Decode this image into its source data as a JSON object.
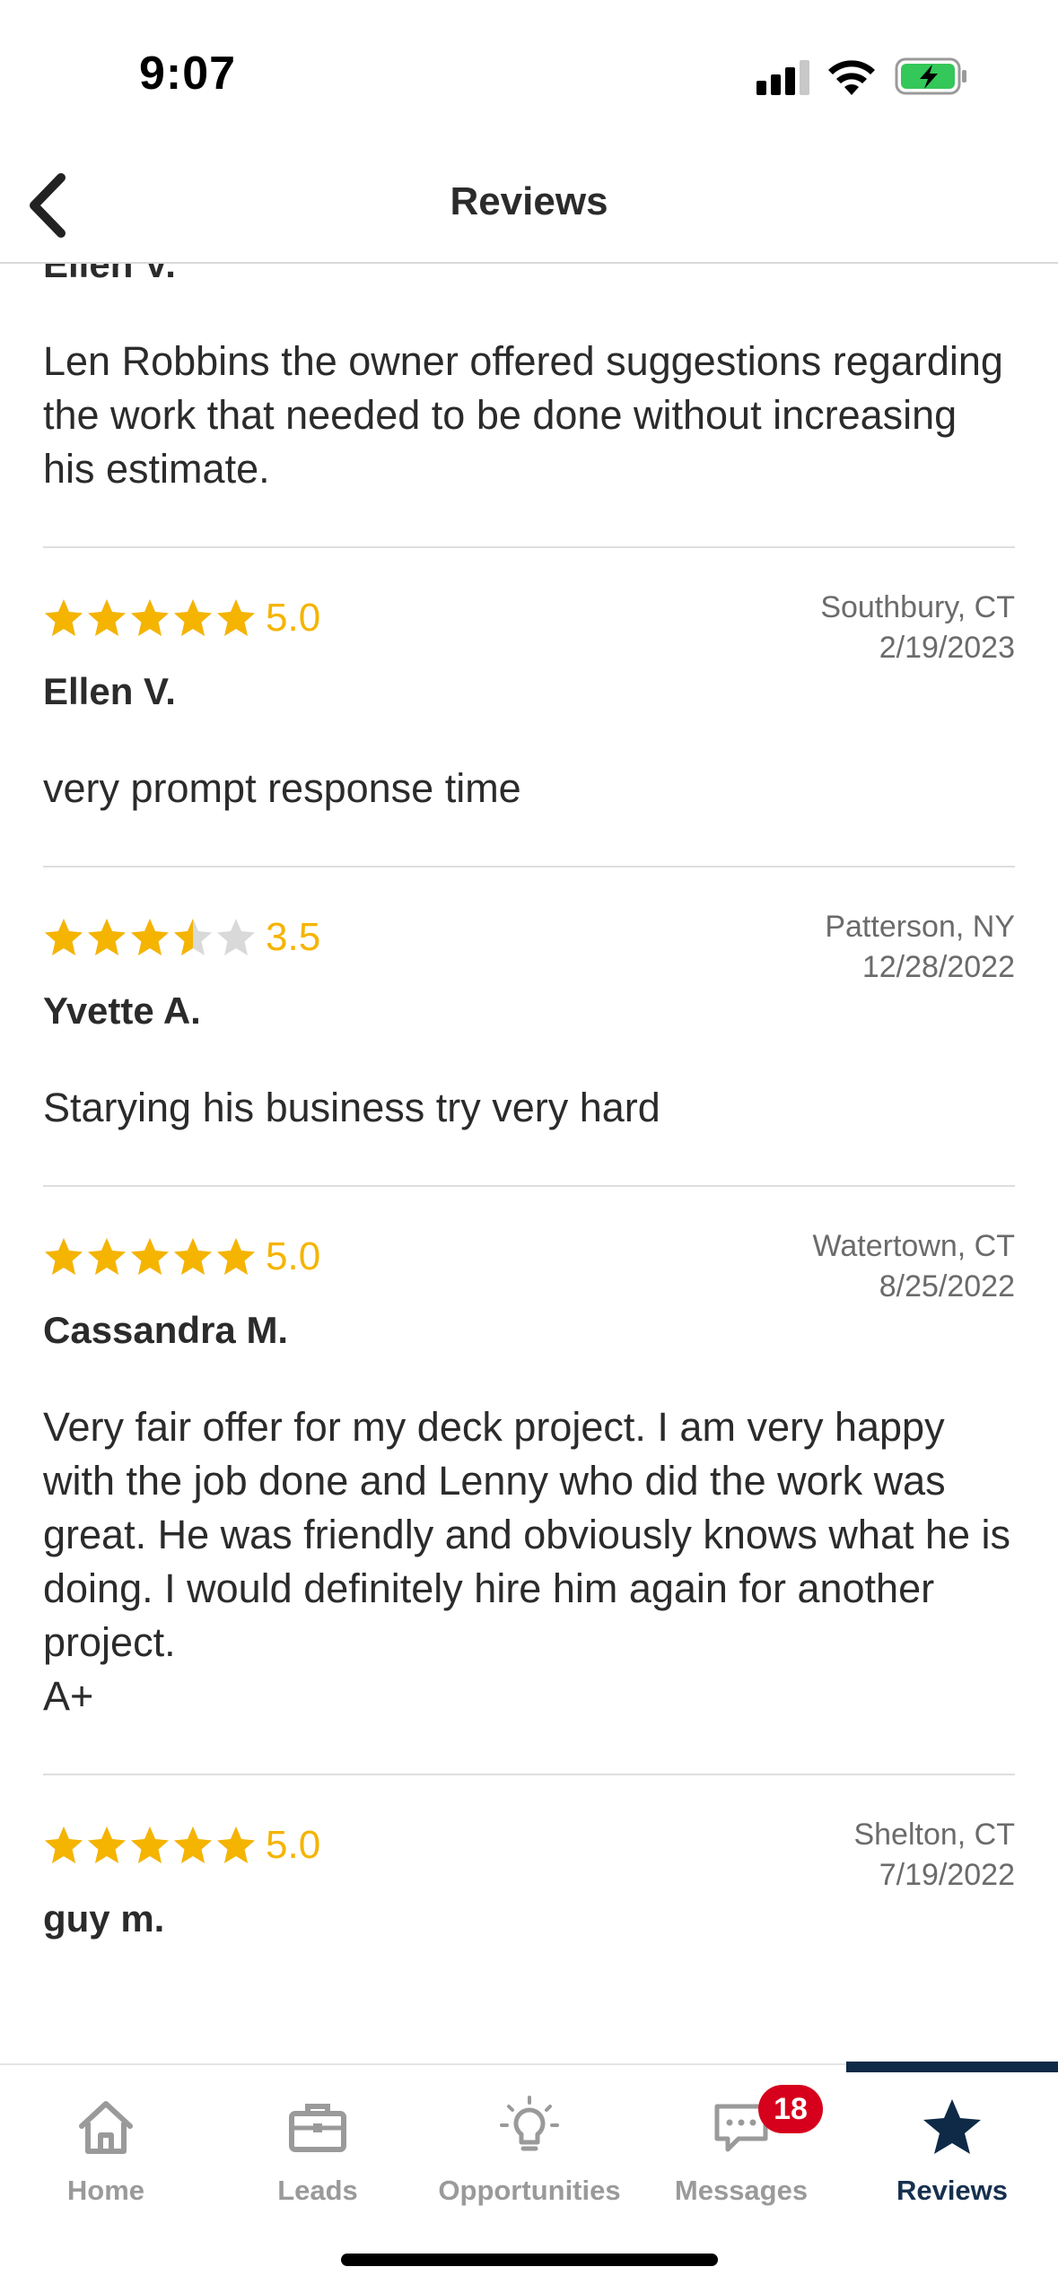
{
  "status_bar": {
    "time": "9:07"
  },
  "header": {
    "title": "Reviews"
  },
  "colors": {
    "star": "#F5B400",
    "star_empty": "#D9D9D9",
    "accent": "#0E2A47",
    "badge": "#D6001C"
  },
  "reviews": [
    {
      "reviewer": "Ellen V.",
      "body": "Len Robbins the owner offered suggestions regarding the work that needed to be done without increasing his estimate."
    },
    {
      "rating": 5.0,
      "rating_text": "5.0",
      "location": "Southbury, CT",
      "date": "2/19/2023",
      "reviewer": "Ellen V.",
      "body": "very prompt response time"
    },
    {
      "rating": 3.5,
      "rating_text": "3.5",
      "location": "Patterson, NY",
      "date": "12/28/2022",
      "reviewer": "Yvette A.",
      "body": "Starying his business try very hard"
    },
    {
      "rating": 5.0,
      "rating_text": "5.0",
      "location": "Watertown, CT",
      "date": "8/25/2022",
      "reviewer": "Cassandra M.",
      "body": "Very fair offer for my deck project. I am very happy with the job done and Lenny who did the work was great. He was friendly and obviously knows what he is doing. I would definitely hire him again for another project.\nA+"
    },
    {
      "rating": 5.0,
      "rating_text": "5.0",
      "location": "Shelton, CT",
      "date": "7/19/2022",
      "reviewer": "guy m.",
      "body": ""
    }
  ],
  "tabs": [
    {
      "label": "Home",
      "icon": "home-icon"
    },
    {
      "label": "Leads",
      "icon": "briefcase-icon"
    },
    {
      "label": "Opportunities",
      "icon": "lightbulb-icon"
    },
    {
      "label": "Messages",
      "icon": "chat-icon",
      "badge": "18"
    },
    {
      "label": "Reviews",
      "icon": "star-icon",
      "active": true
    }
  ]
}
